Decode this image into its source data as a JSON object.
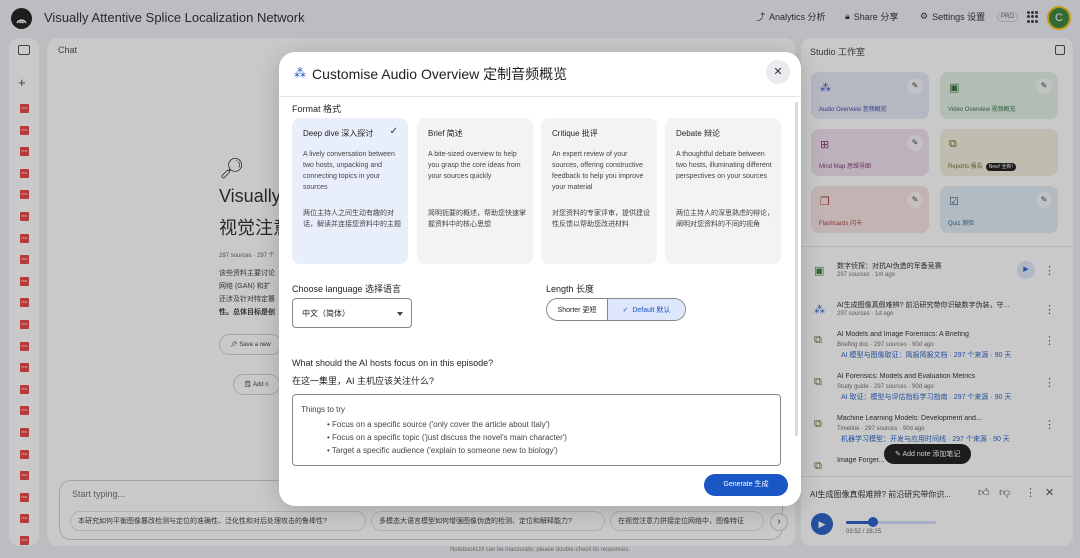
{
  "app": {
    "title": "Visually Attentive Splice Localization Network",
    "analytics_label": "Analytics 分析",
    "share_label": "Share 分享",
    "settings_label": "Settings 设置",
    "pro_badge": "PRO",
    "avatar_letter": "C"
  },
  "chat": {
    "header": "Chat",
    "title_line1": "Visually",
    "title_line2": "视觉注意",
    "meta": "297 sources · 297 个",
    "summary_lines": [
      "该些资料主要讨论",
      "网络 (GAN) 和扩",
      "还涉及针对特定篡",
      "性。总体目标是创"
    ],
    "chip_save": "Save a new",
    "chip_add": "Add n",
    "input_placeholder": "Start typing...",
    "suggestions": [
      "本研究如何平衡图像篡改检测与定位的准确性、泛化性和对后处理攻击的鲁棒性?",
      "多模态大语言模型如何增强图像伪造的检测、定位和解释能力?",
      "在视觉注意力拼接定位网络中，图像特征"
    ],
    "footer": "NotebookLM can be inaccurate; please double-check its responses."
  },
  "studio": {
    "header": "Studio 工作室",
    "tiles": [
      {
        "label": "Audio Overview 音频概览",
        "icon": "audio-waveform-icon",
        "bg": "#e3e6f7",
        "color": "#2f3fa6"
      },
      {
        "label": "Video Overview 视频概览",
        "icon": "video-icon",
        "bg": "#dff0e3",
        "color": "#2f6a3a"
      },
      {
        "label": "Mind Map 思维导图",
        "icon": "mind-map-icon",
        "bg": "#efe0ec",
        "color": "#7b2c6f"
      },
      {
        "label": "Reports 报告",
        "icon": "reports-icon",
        "bg": "#f1efdc",
        "color": "#6b5f1d"
      },
      {
        "label": "Flashcards 闪卡",
        "icon": "flashcards-icon",
        "bg": "#f7e2e2",
        "color": "#a12f2f"
      },
      {
        "label": "Quiz 测验",
        "icon": "quiz-icon",
        "bg": "#dfecf6",
        "color": "#24577e"
      }
    ],
    "reports_badge": "New! 全新!",
    "notes": [
      {
        "title": "数字侦探：对抗AI伪造的军备竞赛",
        "meta": "297 sources · 1m ago",
        "link": ""
      },
      {
        "title": "AI生成图像真假难辨? 前沿研究带你识破数字伪装，守...",
        "meta": "297 sources · 1d ago",
        "link": ""
      },
      {
        "title": "AI Models and Image Forensics: A Briefing",
        "meta": "Briefing doc · 297 sources · 90d ago",
        "link": "AI 模型与图像取证：简报简报文档 · 297 个来源 · 90 天"
      },
      {
        "title": "AI Forensics: Models and Evaluation Metrics",
        "meta": "Study guide · 297 sources · 90d ago",
        "link": "AI 取证：模型与评估指标学习指南 · 297 个来源 · 90 天"
      },
      {
        "title": "Machine Learning Models: Development and...",
        "meta": "Timeline · 297 sources · 90d ago",
        "link": "机器学习模型：开发与应用时间线 · 297 个来源 · 90 天"
      },
      {
        "title": "Image Forger...",
        "meta": "",
        "link": ""
      }
    ],
    "add_note_label": "Add note 添加笔记",
    "player": {
      "title": "AI生成图像真假难辨? 前沿研究带你识...",
      "time": "03:52 / 28:25",
      "progress": 0.136
    }
  },
  "modal": {
    "title": "Customise Audio Overview 定制音频概览",
    "format_label": "Format 格式",
    "formats": [
      {
        "title": "Deep dive 深入探讨",
        "desc": "A lively conversation between two hosts, unpacking and connecting topics in your sources",
        "desc_cn": "两位主持人之间生动有趣的对话，解读并连接您资料中的主题",
        "selected": true
      },
      {
        "title": "Brief 简述",
        "desc": "A bite-sized overview to help you grasp the core ideas from your sources quickly",
        "desc_cn": "简明扼要的概述，帮助您快速掌握资料中的核心思想",
        "selected": false
      },
      {
        "title": "Critique 批评",
        "desc": "An expert review of your sources, offering constructive feedback to help you improve your material",
        "desc_cn": "对您资料的专家评审，提供建设性反馈以帮助您改进材料",
        "selected": false
      },
      {
        "title": "Debate 辩论",
        "desc": "A thoughtful debate between two hosts, illuminating different perspectives on your sources",
        "desc_cn": "两位主持人的深思熟虑的辩论，阐明对您资料的不同的视角",
        "selected": false
      }
    ],
    "language_label": "Choose language 选择语言",
    "language_value": "中文（简体）",
    "length_label": "Length 长度",
    "length_options": [
      "Shorter 更短",
      "Default 默认"
    ],
    "length_selected": "Default 默认",
    "focus_question": "What should the AI hosts focus on in this episode?",
    "focus_question_cn": "在这一集里，AI 主机应该关注什么?",
    "focus_placeholder": "Things to try",
    "focus_bullets": [
      "• Focus on a specific source ('only cover the article about Italy')",
      "• Focus on a specific topic ('just discuss the novel's main character')",
      "• Target a specific audience ('explain to someone new to biology')"
    ],
    "generate_label": "Generate 生成"
  },
  "colors": {
    "accent": "#1a56c4",
    "scrim": "rgba(60,60,60,0.28)"
  }
}
